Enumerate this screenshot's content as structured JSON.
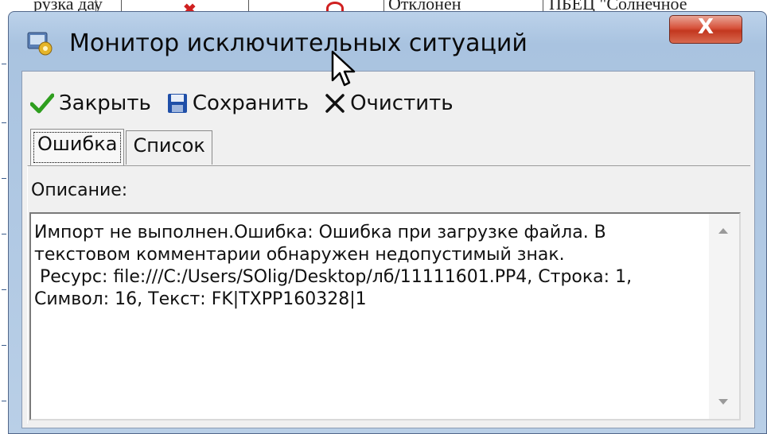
{
  "background": {
    "cell_1": "рузка дау",
    "cell_2": "Отклонен",
    "cell_3": "ПБЕЦ \"Солнечное"
  },
  "window": {
    "title": "Монитор исключительных ситуаций",
    "close_label": "X"
  },
  "toolbar": {
    "close_label": "Закрыть",
    "save_label": "Сохранить",
    "clear_label": "Очистить"
  },
  "tabs": [
    {
      "label": "Ошибка",
      "active": true
    },
    {
      "label": "Список",
      "active": false
    }
  ],
  "panel": {
    "description_label": "Описание:",
    "description_text": "Импорт не выполнен.Ошибка: Ошибка при загрузке файла. В\nтекстовом комментарии обнаружен недопустимый знак.\n Ресурс: file:///C:/Users/SOlig/Desktop/лб/11111601.PP4, Строка: 1,\nСимвол: 16, Текст: FK|TXPP160328|1"
  },
  "colors": {
    "accept_check": "#2e9e1e",
    "save_disk": "#1f4fa8",
    "close_button": "#c8452c"
  },
  "icons": [
    "app-icon",
    "check-icon",
    "floppy-disk-icon",
    "x-icon",
    "mouse-cursor-icon"
  ]
}
